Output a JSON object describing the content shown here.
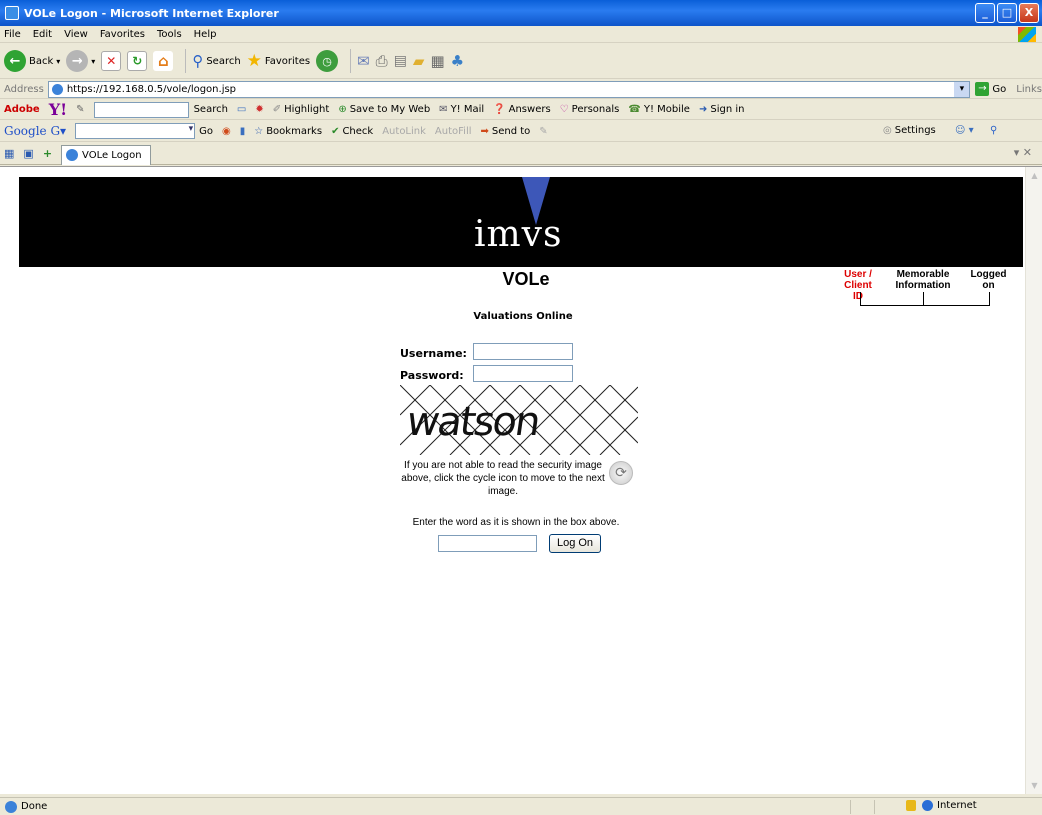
{
  "window": {
    "title": "VOLe Logon - Microsoft Internet Explorer",
    "controls": {
      "minimize": "_",
      "maximize": "□",
      "close": "X"
    }
  },
  "menu": [
    "File",
    "Edit",
    "View",
    "Favorites",
    "Tools",
    "Help"
  ],
  "toolbar": {
    "back": "Back",
    "search": "Search",
    "favorites": "Favorites"
  },
  "address": {
    "label": "Address",
    "url": "https://192.168.0.5/vole/logon.jsp",
    "go": "Go",
    "links": "Links"
  },
  "adobe_bar": {
    "adobe": "Adobe",
    "search": "Search",
    "highlight": "Highlight",
    "save_to_my_web": "Save to My Web",
    "mail": "Y! Mail",
    "answers": "Answers",
    "personals": "Personals",
    "mobile": "Y! Mobile",
    "sign_in": "Sign in"
  },
  "google_bar": {
    "go": "Go",
    "bookmarks": "Bookmarks",
    "check": "Check",
    "autolink": "AutoLink",
    "autofill": "AutoFill",
    "send_to": "Send to",
    "settings": "Settings"
  },
  "tab": {
    "label": "VOLe Logon"
  },
  "page": {
    "logo": "imvs",
    "title": "VOLe",
    "subtitle": "Valuations Online",
    "steps": [
      {
        "label": "User / Client ID",
        "active": true
      },
      {
        "label": "Memorable Information",
        "active": false
      },
      {
        "label": "Logged on",
        "active": false
      }
    ],
    "username_label": "Username:",
    "password_label": "Password:",
    "captcha_word": "watson",
    "help_text": "If you are not able to read the security image above, click the cycle icon to move to the next image.",
    "enter_word": "Enter the word as it is shown in the box above.",
    "logon_button": "Log On",
    "colors": {
      "active_step": "#dd0000",
      "banner": "#000000",
      "logo_accent": "#3d57b8"
    }
  },
  "status": {
    "text": "Done",
    "zone": "Internet"
  }
}
